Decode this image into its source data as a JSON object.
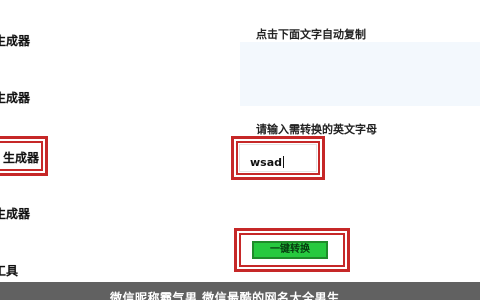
{
  "sidebar": {
    "items": [
      {
        "label": "生成器"
      },
      {
        "label": "生成器"
      },
      {
        "label": "生成器"
      },
      {
        "label": "生成器"
      },
      {
        "label": "工具"
      }
    ]
  },
  "pane": {
    "hint": "点击下面文字自动复制",
    "input_label": "请输入需转换的英文字母",
    "input_value": "wsad",
    "action_label": "一键转换"
  },
  "caption": {
    "text": "微信昵称霸气男 微信最酷的网名大全男生"
  }
}
